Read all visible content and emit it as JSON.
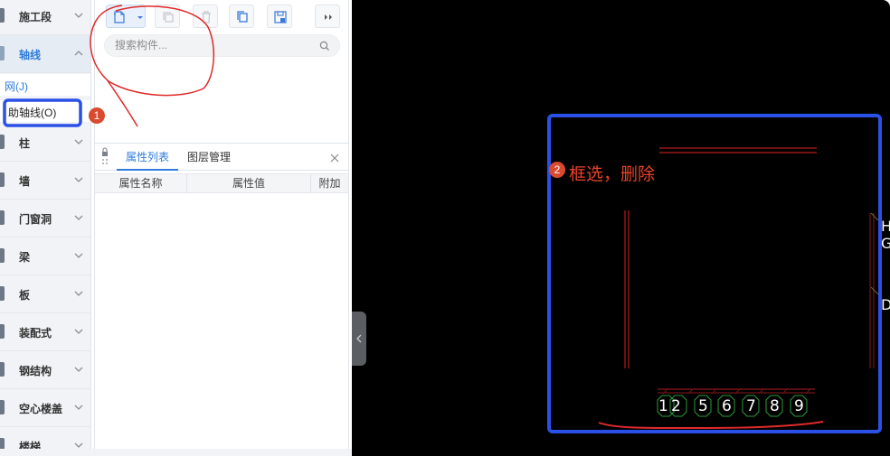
{
  "sidebar": {
    "categories": [
      {
        "label": "施工段"
      },
      {
        "label": "轴线"
      },
      {
        "label": "柱"
      },
      {
        "label": "墙"
      },
      {
        "label": "门窗洞"
      },
      {
        "label": "梁"
      },
      {
        "label": "板"
      },
      {
        "label": "装配式"
      },
      {
        "label": "钢结构"
      },
      {
        "label": "空心楼盖"
      },
      {
        "label": "楼梯"
      }
    ],
    "subitems": [
      {
        "label": "网(J)"
      },
      {
        "label": "助轴线(O)"
      }
    ]
  },
  "toolbar": {
    "buttons": [
      "new-component",
      "copy",
      "delete",
      "duplicate",
      "save-template",
      "expand"
    ]
  },
  "search": {
    "placeholder": "搜索构件..."
  },
  "properties": {
    "tabs": [
      "属性列表",
      "图层管理"
    ],
    "columns": [
      "属性名称",
      "属性值",
      "附加"
    ]
  },
  "annotations": {
    "badge1": "1",
    "badge2": "2",
    "note2": "框选，删除"
  },
  "canvas": {
    "axis_numbers": [
      "1",
      "2",
      "5",
      "6",
      "7",
      "8",
      "9"
    ],
    "axis_letters": [
      "H",
      "G",
      "D"
    ]
  },
  "colors": {
    "accent": "#2f7cdb",
    "annotation_red": "#e8432b",
    "selection_blue": "#2b50e8",
    "canvas_bg": "#000000"
  }
}
